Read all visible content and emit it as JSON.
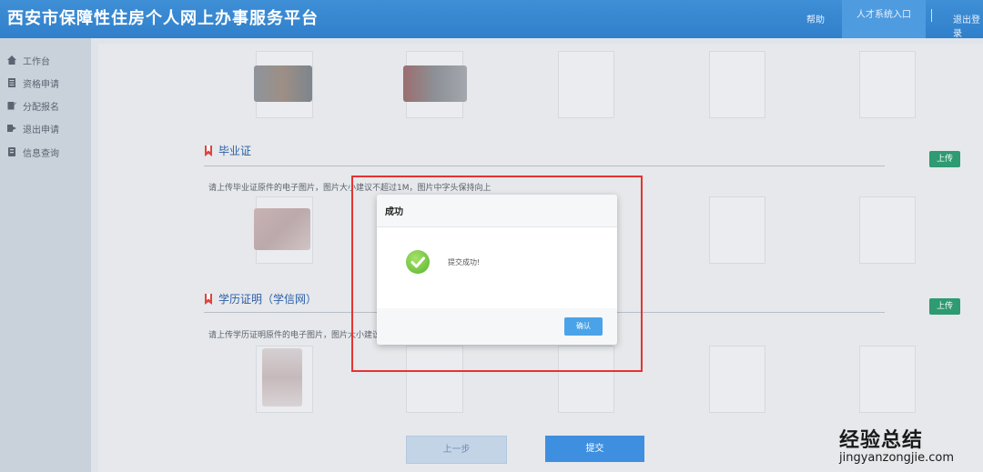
{
  "header": {
    "title": "西安市保障性住房个人网上办事服务平台",
    "nav": [
      "帮助",
      "人才系统入口",
      "退出登录"
    ]
  },
  "sidebar": {
    "items": [
      {
        "label": "工作台",
        "icon": "home-icon"
      },
      {
        "label": "资格申请",
        "icon": "document-icon"
      },
      {
        "label": "分配报名",
        "icon": "edit-icon"
      },
      {
        "label": "退出申请",
        "icon": "exit-icon"
      },
      {
        "label": "信息查询",
        "icon": "info-icon"
      }
    ]
  },
  "sections": {
    "graduation": {
      "title": "毕业证",
      "desc": "请上传毕业证原件的电子图片，图片大小建议不超过1M，图片中字头保持向上",
      "upload_label": "上传"
    },
    "education": {
      "title": "学历证明（学信网）",
      "desc": "请上传学历证明原件的电子图片，图片大小建议不",
      "upload_label": "上传"
    }
  },
  "buttons": {
    "prev": "上一步",
    "submit": "提交"
  },
  "dialog": {
    "title": "成功",
    "message": "提交成功!",
    "ok": "确认"
  },
  "watermark": {
    "line1": "经验总结",
    "line2": "jingyanzongjie.com"
  },
  "colors": {
    "header": "#2f7fcb",
    "upload": "#2e9b72",
    "submit": "#3f8fe0",
    "highlight": "#e53333"
  }
}
